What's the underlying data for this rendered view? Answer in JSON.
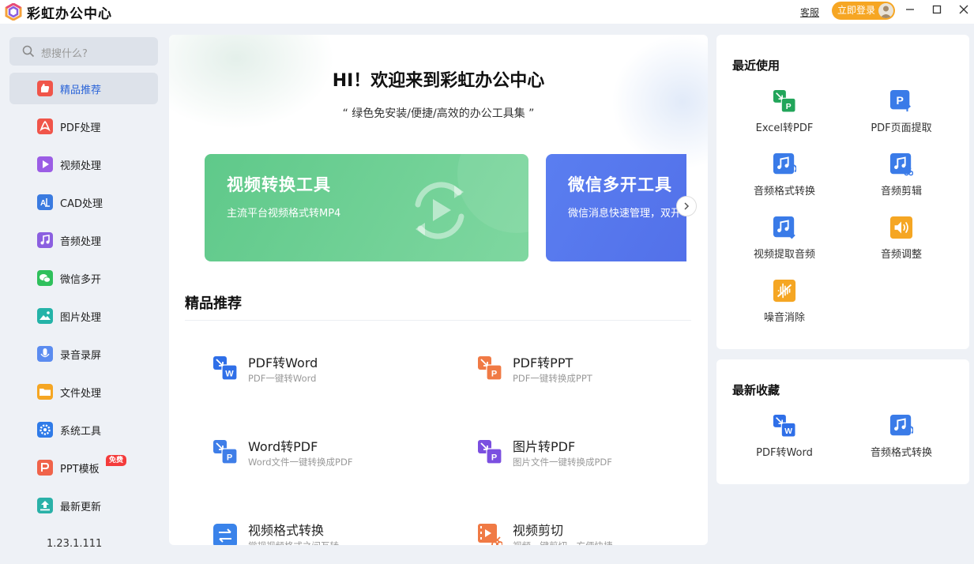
{
  "titlebar": {
    "app_title": "彩虹办公中心",
    "support": "客服",
    "login": "立即登录"
  },
  "sidebar": {
    "search_placeholder": "想搜什么?",
    "items": [
      {
        "label": "精品推荐",
        "color": "#f0554a",
        "active": true
      },
      {
        "label": "PDF处理",
        "color": "#f0554a"
      },
      {
        "label": "视频处理",
        "color": "#9b5de5"
      },
      {
        "label": "CAD处理",
        "color": "#3a7be0"
      },
      {
        "label": "音频处理",
        "color": "#8b5fe0"
      },
      {
        "label": "微信多开",
        "color": "#2fc05c"
      },
      {
        "label": "图片处理",
        "color": "#24b3a8"
      },
      {
        "label": "录音录屏",
        "color": "#5b8cf0"
      },
      {
        "label": "文件处理",
        "color": "#f5a623"
      },
      {
        "label": "系统工具",
        "color": "#2f7be8"
      },
      {
        "label": "PPT模板",
        "color": "#f0634a",
        "badge": "免费"
      },
      {
        "label": "最新更新",
        "color": "#2ab1a8"
      }
    ],
    "version": "1.23.1.111"
  },
  "main": {
    "welcome": "HI！欢迎来到彩虹办公中心",
    "tagline": "“ 绿色免安装/便捷/高效的办公工具集 ”",
    "banners": [
      {
        "title": "视频转换工具",
        "subtitle": "主流平台视频格式转MP4"
      },
      {
        "title": "微信多开工具",
        "subtitle": "微信消息快速管理，双开"
      }
    ],
    "section_title": "精品推荐",
    "tools": [
      {
        "name": "PDF转Word",
        "desc": "PDF一键转Word",
        "icon": "pdf-to-word-icon"
      },
      {
        "name": "PDF转PPT",
        "desc": "PDF一键转换成PPT",
        "icon": "pdf-to-ppt-icon"
      },
      {
        "name": "Word转PDF",
        "desc": "Word文件一键转换成PDF",
        "icon": "word-to-pdf-icon"
      },
      {
        "name": "图片转PDF",
        "desc": "图片文件一键转换成PDF",
        "icon": "image-to-pdf-icon"
      },
      {
        "name": "视频格式转换",
        "desc": "常规视频格式之间互转",
        "icon": "video-convert-icon"
      },
      {
        "name": "视频剪切",
        "desc": "视频一键剪切，方便快捷",
        "icon": "video-cut-icon"
      }
    ]
  },
  "recent": {
    "title": "最近使用",
    "items": [
      "Excel转PDF",
      "PDF页面提取",
      "音频格式转换",
      "音频剪辑",
      "视频提取音频",
      "音频调整",
      "噪音消除"
    ]
  },
  "favorites": {
    "title": "最新收藏",
    "items": [
      "PDF转Word",
      "音频格式转换"
    ]
  }
}
